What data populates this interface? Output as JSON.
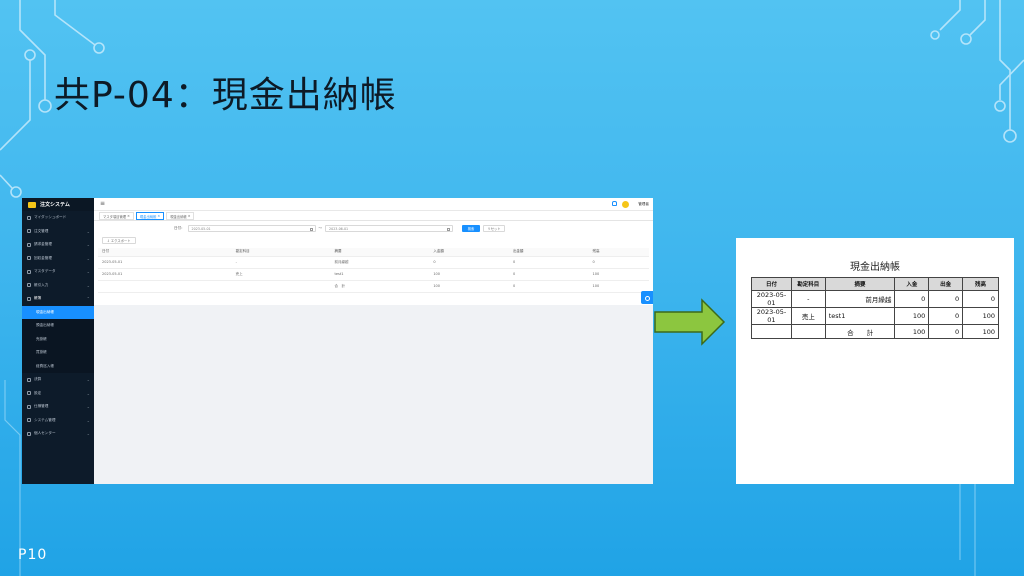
{
  "slide": {
    "title": "共P-04：現金出納帳",
    "page_number": "P10"
  },
  "app": {
    "logo_text": "注文システム",
    "nav": [
      {
        "label": "マイダッシュボード",
        "icon": "dashboard-icon"
      },
      {
        "label": "注文管理",
        "icon": "order-icon"
      },
      {
        "label": "請求金管理",
        "icon": "invoice-icon"
      },
      {
        "label": "回収金管理",
        "icon": "collect-icon"
      },
      {
        "label": "マスタデータ",
        "icon": "master-icon"
      },
      {
        "label": "帳引入力",
        "icon": "entry-icon"
      },
      {
        "label": "帳簿",
        "icon": "book-icon"
      }
    ],
    "sub_nav": [
      "現金出納帳",
      "預金出納帳",
      "売掛帳",
      "買掛帳",
      "経費巡入帳"
    ],
    "nav_bottom": [
      {
        "label": "決算",
        "icon": "settle-icon"
      },
      {
        "label": "設定",
        "icon": "settings-icon"
      },
      {
        "label": "仕様管理",
        "icon": "spec-icon"
      },
      {
        "label": "システム管理",
        "icon": "system-icon"
      },
      {
        "label": "個人センター",
        "icon": "user-icon"
      }
    ],
    "user_name": "管理者",
    "tabs": [
      "マスタ項目管理",
      "現金出納帳",
      "現金出納帳"
    ],
    "filter": {
      "label": "日付：",
      "from": "2023-05-01",
      "separator": "～",
      "to": "2023-06-01",
      "search": "検索",
      "reset": "リセット"
    },
    "export_label": "エクスポート",
    "table": {
      "headers": [
        "日付",
        "勘定科目",
        "摘要",
        "入金額",
        "出金額",
        "残高"
      ],
      "rows": [
        [
          "2023-05-01",
          "-",
          "前月繰越",
          "0",
          "0",
          "0"
        ],
        [
          "2023-05-01",
          "売上",
          "test1",
          "100",
          "0",
          "100"
        ],
        [
          "",
          "",
          "合　計",
          "100",
          "0",
          "100"
        ]
      ]
    }
  },
  "report": {
    "title": "現金出納帳",
    "headers": [
      "日付",
      "勘定科目",
      "摘要",
      "入金",
      "出金",
      "残高"
    ],
    "rows": [
      [
        "2023-05-01",
        "-",
        "前月繰越",
        "0",
        "0",
        "0"
      ],
      [
        "2023-05-01",
        "売上",
        "test1",
        "100",
        "0",
        "100"
      ],
      [
        "",
        "",
        "合　　計",
        "100",
        "0",
        "100"
      ]
    ]
  },
  "colors": {
    "accent": "#1890ff",
    "sidebar": "#0d1b2a",
    "arrow": "#8cc63f"
  }
}
